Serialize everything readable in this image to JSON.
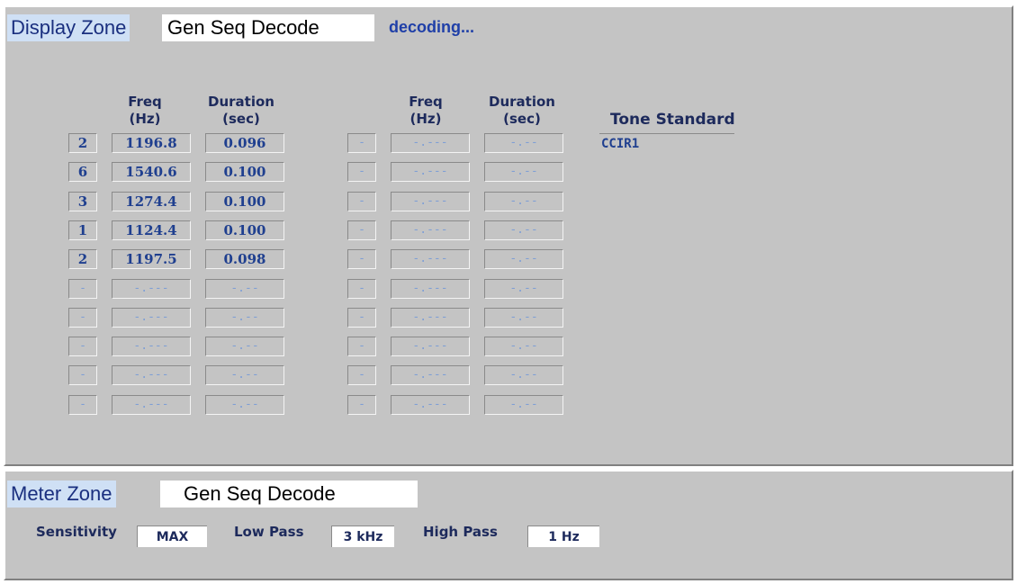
{
  "display_zone": {
    "label": "Display Zone",
    "mode": "Gen Seq Decode",
    "status": "decoding...",
    "headers": {
      "freq": "Freq",
      "freq_unit": "(Hz)",
      "duration": "Duration",
      "duration_unit": "(sec)",
      "tone_standard": "Tone Standard"
    },
    "tone_standard_value": "CCIR1",
    "left_rows": [
      {
        "digit": "2",
        "freq": "1196.8",
        "duration": "0.096",
        "active": true
      },
      {
        "digit": "6",
        "freq": "1540.6",
        "duration": "0.100",
        "active": true
      },
      {
        "digit": "3",
        "freq": "1274.4",
        "duration": "0.100",
        "active": true
      },
      {
        "digit": "1",
        "freq": "1124.4",
        "duration": "0.100",
        "active": true
      },
      {
        "digit": "2",
        "freq": "1197.5",
        "duration": "0.098",
        "active": true
      },
      {
        "digit": "-",
        "freq": "-.---",
        "duration": "-.--",
        "active": false
      },
      {
        "digit": "-",
        "freq": "-.---",
        "duration": "-.--",
        "active": false
      },
      {
        "digit": "-",
        "freq": "-.---",
        "duration": "-.--",
        "active": false
      },
      {
        "digit": "-",
        "freq": "-.---",
        "duration": "-.--",
        "active": false
      },
      {
        "digit": "-",
        "freq": "-.---",
        "duration": "-.--",
        "active": false
      }
    ],
    "right_rows": [
      {
        "digit": "-",
        "freq": "-.---",
        "duration": "-.--"
      },
      {
        "digit": "-",
        "freq": "-.---",
        "duration": "-.--"
      },
      {
        "digit": "-",
        "freq": "-.---",
        "duration": "-.--"
      },
      {
        "digit": "-",
        "freq": "-.---",
        "duration": "-.--"
      },
      {
        "digit": "-",
        "freq": "-.---",
        "duration": "-.--"
      },
      {
        "digit": "-",
        "freq": "-.---",
        "duration": "-.--"
      },
      {
        "digit": "-",
        "freq": "-.---",
        "duration": "-.--"
      },
      {
        "digit": "-",
        "freq": "-.---",
        "duration": "-.--"
      },
      {
        "digit": "-",
        "freq": "-.---",
        "duration": "-.--"
      },
      {
        "digit": "-",
        "freq": "-.---",
        "duration": "-.--"
      }
    ]
  },
  "meter_zone": {
    "label": "Meter Zone",
    "mode": "Gen Seq Decode",
    "sensitivity_label": "Sensitivity",
    "sensitivity_value": "MAX",
    "low_pass_label": "Low Pass",
    "low_pass_value": "3 kHz",
    "high_pass_label": "High Pass",
    "high_pass_value": "1 Hz"
  },
  "colors": {
    "panel_bg": "#c4c4c4",
    "value_text": "#1f3f8f",
    "placeholder_text": "#7f9fd5",
    "label_text": "#1d2a5c",
    "zone_label_bg": "#cfe0f5"
  }
}
